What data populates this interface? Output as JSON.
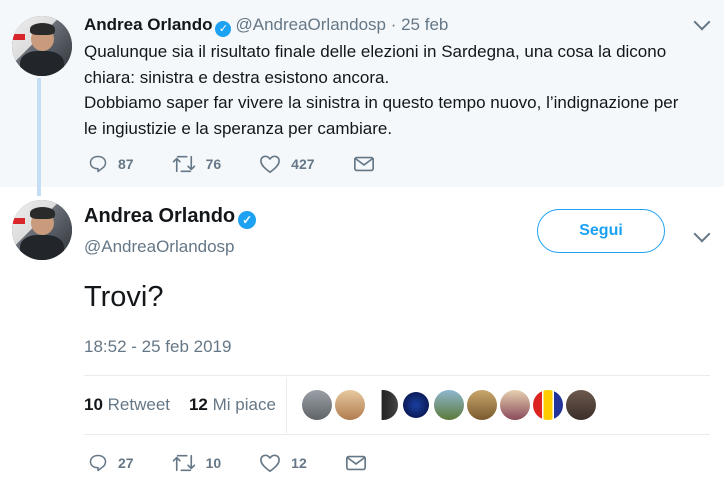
{
  "parent_tweet": {
    "author_name": "Andrea Orlando",
    "handle": "@AndreaOrlandosp",
    "date": "· 25 feb",
    "lines": [
      "Qualunque sia il risultato finale delle elezioni in Sardegna, una cosa la dicono",
      "chiara: sinistra e destra esistono ancora.",
      "Dobbiamo saper far vivere la sinistra in questo tempo nuovo, l’indignazione per",
      "le ingiustizie e la speranza per cambiare."
    ],
    "replies": "87",
    "retweets": "76",
    "likes": "427"
  },
  "main_tweet": {
    "author_name": "Andrea Orlando",
    "handle": "@AndreaOrlandosp",
    "follow_label": "Segui",
    "text": "Trovi?",
    "timestamp": "18:52 - 25 feb 2019",
    "retweet_count": "10",
    "retweet_label": "Retweet",
    "like_count": "12",
    "like_label": "Mi piace",
    "replies": "27",
    "retweets": "10",
    "likes": "12"
  },
  "icons": [
    "verified-icon",
    "chevron-down-icon",
    "reply-icon",
    "retweet-icon",
    "like-icon",
    "message-icon"
  ],
  "colors": {
    "accent": "#1da1f2",
    "muted": "#657786",
    "parent_bg": "#f5f8fa"
  }
}
